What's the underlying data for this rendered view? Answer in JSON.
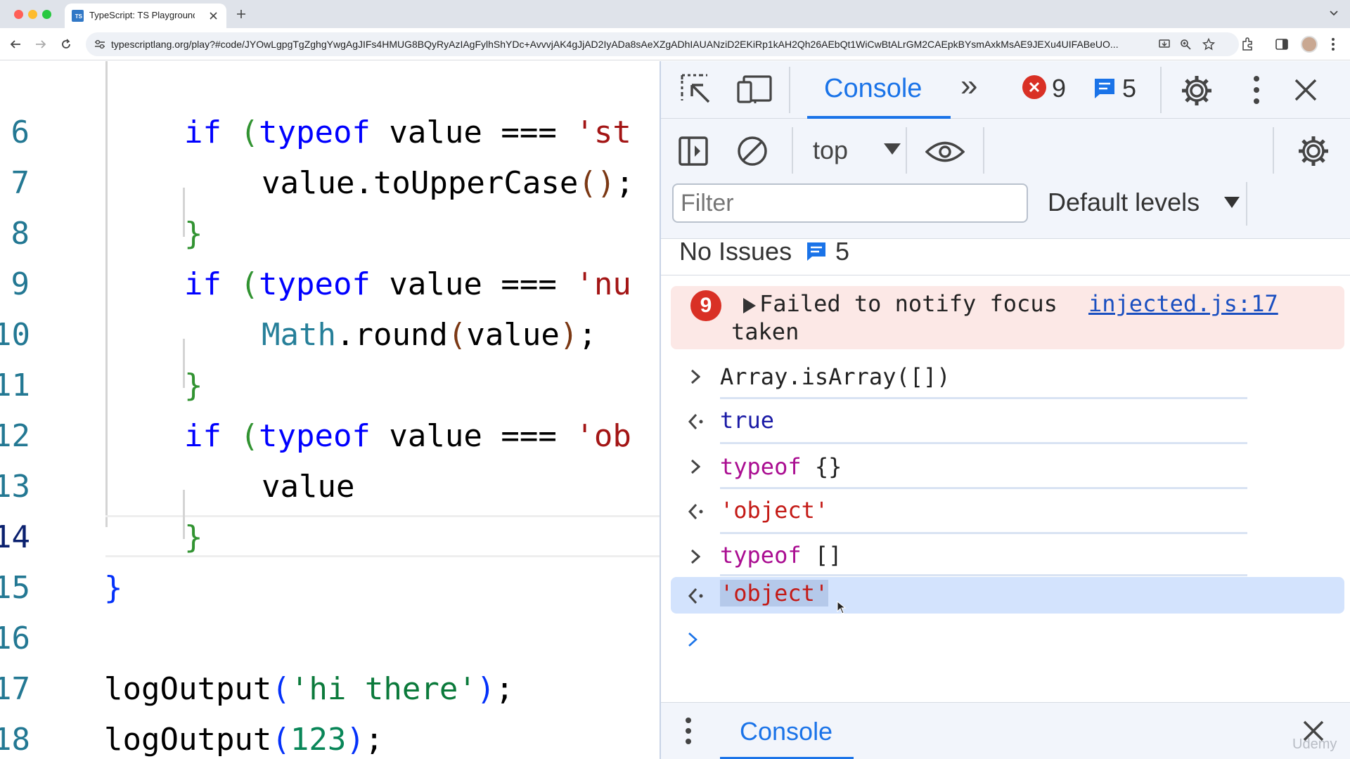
{
  "browser": {
    "tab_title": "TypeScript: TS Playground - /",
    "favicon_text": "TS",
    "url": "typescriptlang.org/play?#code/JYOwLgpgTgZghgYwgAgJIFs4HMUG8BQyRyAzIAgFylhShYDc+AvvvjAK4gJjAD2IyADa8sAeXZgADhIAUANziD2EKiRp1kAH2Qh26AEbQt1WiCwBtALrGM2CAEpkBYsmAxkMsAE9JEXu4UIFABeUO..."
  },
  "editor": {
    "line_numbers": [
      "6",
      "7",
      "8",
      "9",
      "10",
      "11",
      "12",
      "13",
      "14",
      "15",
      "16",
      "17",
      "18"
    ],
    "lines": {
      "l6": {
        "kw": "if",
        "p": "(",
        "ty": "typeof",
        "rest": " value === ",
        "str": "'st"
      },
      "l7": {
        "id": "value.toUpperCase",
        "p": "()",
        "end": ";"
      },
      "l8": {
        "brace": "}"
      },
      "l9": {
        "kw": "if",
        "p": "(",
        "ty": "typeof",
        "rest": " value === ",
        "str": "'nu"
      },
      "l10": {
        "obj": "Math",
        "id": ".round",
        "p1": "(",
        "arg": "value",
        "p2": ")",
        "end": ";"
      },
      "l11": {
        "brace": "}"
      },
      "l12": {
        "kw": "if",
        "p": "(",
        "ty": "typeof",
        "rest": " value === ",
        "str": "'ob"
      },
      "l13": {
        "id": "value"
      },
      "l14": {
        "brace": "}"
      },
      "l15": {
        "brace": "}"
      },
      "l17": {
        "fn": "logOutput",
        "p1": "(",
        "str": "'hi there'",
        "p2": ")",
        "end": ";"
      },
      "l18": {
        "fn": "logOutput",
        "p1": "(",
        "num": "123",
        "p2": ")",
        "end": ";"
      }
    }
  },
  "devtools": {
    "tabs": {
      "console": "Console",
      "more": "»"
    },
    "error_count": "9",
    "message_count": "5",
    "context": "top",
    "filter_placeholder": "Filter",
    "levels": "Default levels",
    "issues_label": "No Issues",
    "issues_count": "5",
    "error_entry": {
      "badge": "9",
      "text_line1": "Failed to notify focus",
      "text_line2": "taken",
      "source": "injected.js:17"
    },
    "entries": [
      {
        "kind": "input",
        "text": "Array.isArray([])"
      },
      {
        "kind": "output",
        "text": "true"
      },
      {
        "kind": "input",
        "kw": "typeof",
        "text": " {}"
      },
      {
        "kind": "output",
        "text": "'object'"
      },
      {
        "kind": "input",
        "kw": "typeof",
        "text": " []"
      },
      {
        "kind": "output",
        "text": "'object'"
      }
    ],
    "drawer_tab": "Console",
    "watermark": "Udemy"
  },
  "colors": {
    "accent": "#1a73e8",
    "error": "#d93025",
    "error_bg": "#fce8e6",
    "selected_row": "#d3e3fd"
  }
}
